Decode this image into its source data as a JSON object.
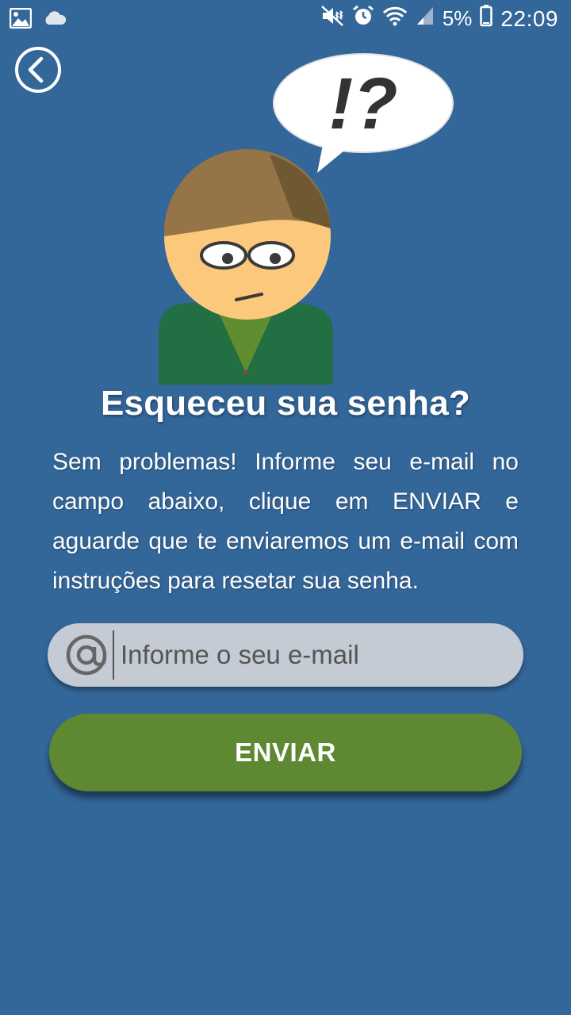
{
  "status_bar": {
    "battery_percent": "5%",
    "time": "22:09",
    "icons": [
      "image-icon",
      "cloud-icon",
      "mute-vibrate-icon",
      "alarm-icon",
      "wifi-icon",
      "signal-icon",
      "battery-icon"
    ]
  },
  "back_button": {
    "icon": "chevron-left-circle-icon"
  },
  "illustration": {
    "bubble_text": "!?"
  },
  "title": "Esqueceu sua senha?",
  "description": "Sem problemas! Informe seu e-mail no campo abaixo, clique em ENVIAR e aguarde que te enviaremos um e-mail com instruções para resetar sua senha.",
  "email_field": {
    "icon": "at-icon",
    "placeholder": "Informe o seu e-mail",
    "value": ""
  },
  "send_button": {
    "label": "ENVIAR"
  },
  "colors": {
    "background": "#336699",
    "button": "#5f8832",
    "field": "#c4cbd4",
    "text": "#ffffff"
  }
}
